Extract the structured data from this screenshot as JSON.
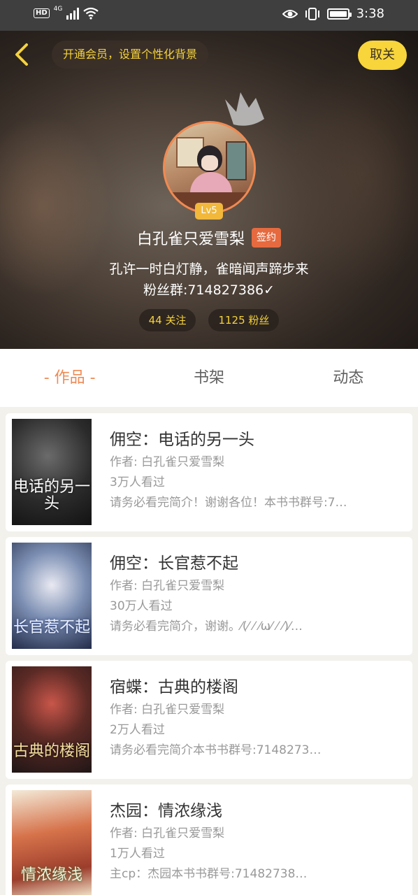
{
  "status_bar": {
    "network": "4G",
    "hd": "HD",
    "time": "3:38"
  },
  "header": {
    "vip_banner": "开通会员，设置个性化背景",
    "unfollow_label": "取关",
    "level": "Lv5",
    "username": "白孔雀只爱雪梨",
    "signed_badge": "签约",
    "bio_line1": "孔许一时白灯静，雀暗闻声蹄步来",
    "bio_line2": "粉丝群:714827386✓",
    "following": "44 关注",
    "followers": "1125 粉丝"
  },
  "tabs": [
    {
      "label": "- 作品 -",
      "active": true
    },
    {
      "label": "书架",
      "active": false
    },
    {
      "label": "动态",
      "active": false
    }
  ],
  "works": [
    {
      "title": "佣空：电话的另一头",
      "author": "作者: 白孔雀只爱雪梨",
      "views": "3万人看过",
      "intro": "请务必看完简介！谢谢各位！本书书群号:7…",
      "cover_text": "电话的另一头"
    },
    {
      "title": "佣空：长官惹不起",
      "author": "作者: 白孔雀只爱雪梨",
      "views": "30万人看过",
      "intro": "请务必看完简介，谢谢。⁄(⁄ ⁄ ⁄ω⁄ ⁄ ⁄)⁄…",
      "cover_text": "长官惹不起"
    },
    {
      "title": "宿蝶：古典的楼阁",
      "author": "作者: 白孔雀只爱雪梨",
      "views": "2万人看过",
      "intro": "请务必看完简介本书书群号:7148273…",
      "cover_text": "古典的楼阁"
    },
    {
      "title": "杰园：情浓缘浅",
      "author": "作者: 白孔雀只爱雪梨",
      "views": "1万人看过",
      "intro": "主cp：杰园本书书群号:71482738…",
      "cover_text": "情浓缘浅"
    }
  ],
  "colors": {
    "accent": "#ef8a55",
    "gold": "#f5d23a",
    "signed": "#e66a3f",
    "level": "#f1b83c"
  },
  "icons": [
    "back-chevron-icon",
    "crown-icon",
    "wifi-icon",
    "eye-icon",
    "vibrate-icon",
    "battery-icon"
  ]
}
